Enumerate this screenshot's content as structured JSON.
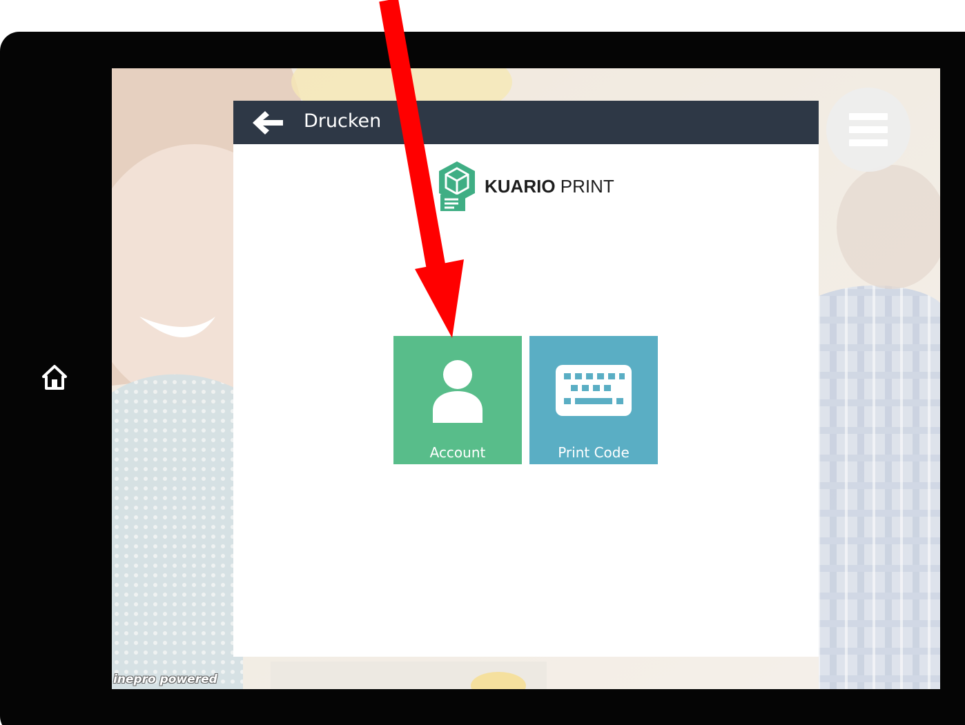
{
  "header": {
    "title": "Drucken"
  },
  "brand": {
    "name_bold": "KUARIO",
    "name_light": " PRINT"
  },
  "tiles": [
    {
      "label": "Account",
      "icon": "user-icon",
      "color": "#58bd8a"
    },
    {
      "label": "Print Code",
      "icon": "keyboard-icon",
      "color": "#5aaec4"
    }
  ],
  "footer": {
    "powered": "inepro powered"
  },
  "colors": {
    "header_bg": "#2e3846",
    "annotation_arrow": "#ff0000",
    "bezel": "#050505"
  },
  "icons": [
    "home-icon",
    "back-arrow-icon",
    "hamburger-menu-icon",
    "kuario-logo-icon",
    "user-icon",
    "keyboard-icon"
  ]
}
